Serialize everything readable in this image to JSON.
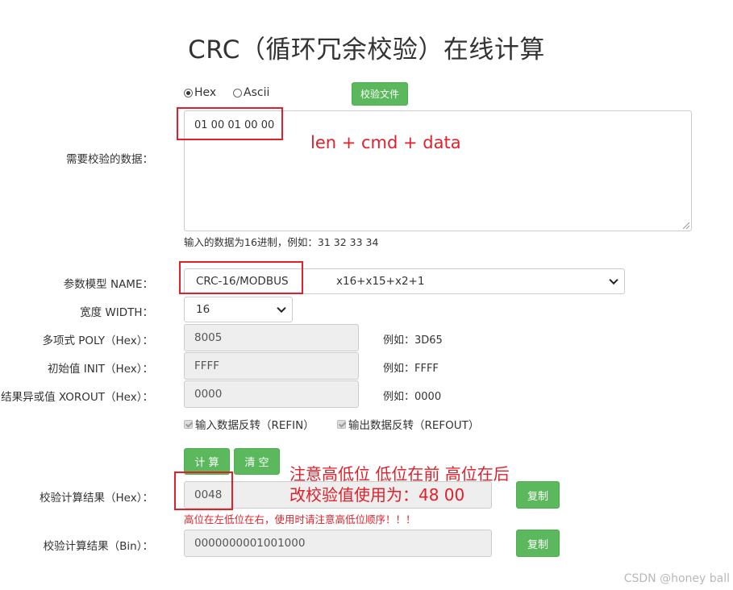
{
  "page": {
    "title": "CRC（循环冗余校验）在线计算"
  },
  "input_mode": {
    "hex_label": "Hex",
    "ascii_label": "Ascii",
    "selected": "Hex"
  },
  "check_file_button": "校验文件",
  "data_section": {
    "label": "需要校验的数据：",
    "value": "01 00 01 00 00",
    "hint": "输入的数据为16进制，例如：31 32 33 34"
  },
  "model": {
    "label": "参数模型 NAME：",
    "selected_name": "CRC-16/MODBUS",
    "selected_formula": "x16+x15+x2+1"
  },
  "width": {
    "label": "宽度 WIDTH：",
    "value": "16"
  },
  "poly": {
    "label": "多项式 POLY（Hex）：",
    "value": "8005",
    "example": "例如：3D65"
  },
  "init": {
    "label": "初始值 INIT（Hex）：",
    "value": "FFFF",
    "example": "例如：FFFF"
  },
  "xorout": {
    "label": "结果异或值 XOROUT（Hex）：",
    "value": "0000",
    "example": "例如：0000"
  },
  "refin_label": "输入数据反转（REFIN）",
  "refout_label": "输出数据反转（REFOUT）",
  "calc_button": "计 算",
  "clear_button": "清 空",
  "result_hex": {
    "label": "校验计算结果（Hex）：",
    "value": "0048",
    "copy": "复制"
  },
  "warning": "高位在左低位在右，使用时请注意高低位顺序！！！",
  "result_bin": {
    "label": "校验计算结果（Bin）：",
    "value": "0000000001001000",
    "copy": "复制"
  },
  "annotations": {
    "data_note": "len + cmd + data",
    "order_note": "注意高低位  低位在前 高位在后",
    "value_note": "改校验值使用为：48 00"
  },
  "watermark": "CSDN @honey ball",
  "colors": {
    "accent_green": "#5cb85c",
    "annotation_red": "#e0202a"
  }
}
